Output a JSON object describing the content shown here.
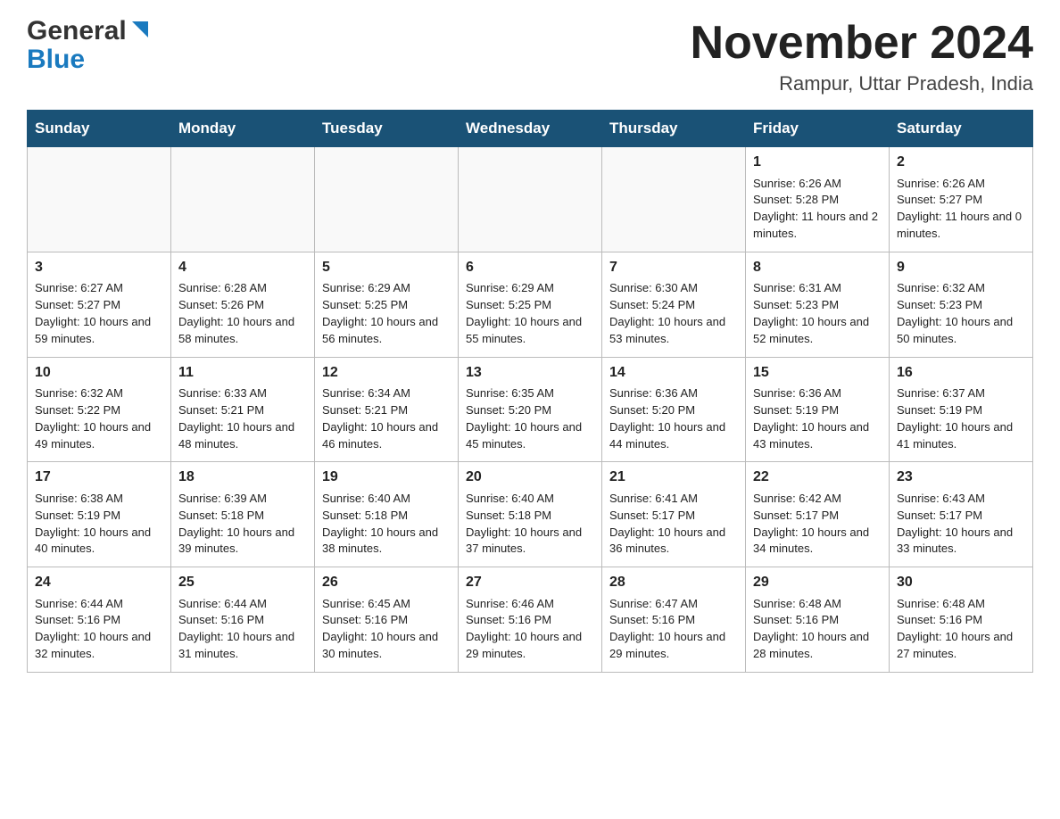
{
  "logo": {
    "general": "General",
    "blue": "Blue"
  },
  "title": {
    "month": "November 2024",
    "location": "Rampur, Uttar Pradesh, India"
  },
  "headers": [
    "Sunday",
    "Monday",
    "Tuesday",
    "Wednesday",
    "Thursday",
    "Friday",
    "Saturday"
  ],
  "weeks": [
    [
      {
        "day": "",
        "info": ""
      },
      {
        "day": "",
        "info": ""
      },
      {
        "day": "",
        "info": ""
      },
      {
        "day": "",
        "info": ""
      },
      {
        "day": "",
        "info": ""
      },
      {
        "day": "1",
        "info": "Sunrise: 6:26 AM\nSunset: 5:28 PM\nDaylight: 11 hours and 2 minutes."
      },
      {
        "day": "2",
        "info": "Sunrise: 6:26 AM\nSunset: 5:27 PM\nDaylight: 11 hours and 0 minutes."
      }
    ],
    [
      {
        "day": "3",
        "info": "Sunrise: 6:27 AM\nSunset: 5:27 PM\nDaylight: 10 hours and 59 minutes."
      },
      {
        "day": "4",
        "info": "Sunrise: 6:28 AM\nSunset: 5:26 PM\nDaylight: 10 hours and 58 minutes."
      },
      {
        "day": "5",
        "info": "Sunrise: 6:29 AM\nSunset: 5:25 PM\nDaylight: 10 hours and 56 minutes."
      },
      {
        "day": "6",
        "info": "Sunrise: 6:29 AM\nSunset: 5:25 PM\nDaylight: 10 hours and 55 minutes."
      },
      {
        "day": "7",
        "info": "Sunrise: 6:30 AM\nSunset: 5:24 PM\nDaylight: 10 hours and 53 minutes."
      },
      {
        "day": "8",
        "info": "Sunrise: 6:31 AM\nSunset: 5:23 PM\nDaylight: 10 hours and 52 minutes."
      },
      {
        "day": "9",
        "info": "Sunrise: 6:32 AM\nSunset: 5:23 PM\nDaylight: 10 hours and 50 minutes."
      }
    ],
    [
      {
        "day": "10",
        "info": "Sunrise: 6:32 AM\nSunset: 5:22 PM\nDaylight: 10 hours and 49 minutes."
      },
      {
        "day": "11",
        "info": "Sunrise: 6:33 AM\nSunset: 5:21 PM\nDaylight: 10 hours and 48 minutes."
      },
      {
        "day": "12",
        "info": "Sunrise: 6:34 AM\nSunset: 5:21 PM\nDaylight: 10 hours and 46 minutes."
      },
      {
        "day": "13",
        "info": "Sunrise: 6:35 AM\nSunset: 5:20 PM\nDaylight: 10 hours and 45 minutes."
      },
      {
        "day": "14",
        "info": "Sunrise: 6:36 AM\nSunset: 5:20 PM\nDaylight: 10 hours and 44 minutes."
      },
      {
        "day": "15",
        "info": "Sunrise: 6:36 AM\nSunset: 5:19 PM\nDaylight: 10 hours and 43 minutes."
      },
      {
        "day": "16",
        "info": "Sunrise: 6:37 AM\nSunset: 5:19 PM\nDaylight: 10 hours and 41 minutes."
      }
    ],
    [
      {
        "day": "17",
        "info": "Sunrise: 6:38 AM\nSunset: 5:19 PM\nDaylight: 10 hours and 40 minutes."
      },
      {
        "day": "18",
        "info": "Sunrise: 6:39 AM\nSunset: 5:18 PM\nDaylight: 10 hours and 39 minutes."
      },
      {
        "day": "19",
        "info": "Sunrise: 6:40 AM\nSunset: 5:18 PM\nDaylight: 10 hours and 38 minutes."
      },
      {
        "day": "20",
        "info": "Sunrise: 6:40 AM\nSunset: 5:18 PM\nDaylight: 10 hours and 37 minutes."
      },
      {
        "day": "21",
        "info": "Sunrise: 6:41 AM\nSunset: 5:17 PM\nDaylight: 10 hours and 36 minutes."
      },
      {
        "day": "22",
        "info": "Sunrise: 6:42 AM\nSunset: 5:17 PM\nDaylight: 10 hours and 34 minutes."
      },
      {
        "day": "23",
        "info": "Sunrise: 6:43 AM\nSunset: 5:17 PM\nDaylight: 10 hours and 33 minutes."
      }
    ],
    [
      {
        "day": "24",
        "info": "Sunrise: 6:44 AM\nSunset: 5:16 PM\nDaylight: 10 hours and 32 minutes."
      },
      {
        "day": "25",
        "info": "Sunrise: 6:44 AM\nSunset: 5:16 PM\nDaylight: 10 hours and 31 minutes."
      },
      {
        "day": "26",
        "info": "Sunrise: 6:45 AM\nSunset: 5:16 PM\nDaylight: 10 hours and 30 minutes."
      },
      {
        "day": "27",
        "info": "Sunrise: 6:46 AM\nSunset: 5:16 PM\nDaylight: 10 hours and 29 minutes."
      },
      {
        "day": "28",
        "info": "Sunrise: 6:47 AM\nSunset: 5:16 PM\nDaylight: 10 hours and 29 minutes."
      },
      {
        "day": "29",
        "info": "Sunrise: 6:48 AM\nSunset: 5:16 PM\nDaylight: 10 hours and 28 minutes."
      },
      {
        "day": "30",
        "info": "Sunrise: 6:48 AM\nSunset: 5:16 PM\nDaylight: 10 hours and 27 minutes."
      }
    ]
  ]
}
